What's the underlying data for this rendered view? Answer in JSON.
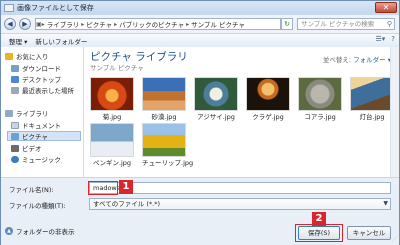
{
  "window": {
    "title": "画像ファイルとして保存",
    "close_glyph": "✕"
  },
  "nav": {
    "back_glyph": "◀",
    "forward_glyph": "▶",
    "breadcrumbs": [
      "ライブラリ",
      "ピクチャ",
      "パブリックのピクチャ",
      "サンプル ピクチャ"
    ],
    "separator": "▸",
    "search_placeholder": "サンプル ピクチャの検索"
  },
  "toolbar": {
    "organize": "整理 ▾",
    "new_folder": "新しいフォルダー"
  },
  "sidebar": {
    "items": [
      {
        "label": "お気に入り",
        "icon": "star-icon",
        "color": "#e8b422"
      },
      {
        "label": "ダウンロード",
        "icon": "download-folder-icon",
        "color": "#7a9cc7"
      },
      {
        "label": "デスクトップ",
        "icon": "desktop-icon",
        "color": "#4f8ad1"
      },
      {
        "label": "最近表示した場所",
        "icon": "recent-places-icon",
        "color": "#9aa8b8"
      },
      {
        "label": "ライブラリ",
        "icon": "library-icon",
        "color": "#8fa9c9"
      },
      {
        "label": "ドキュメント",
        "icon": "documents-icon",
        "color": "#c9d4e0"
      },
      {
        "label": "ピクチャ",
        "icon": "pictures-icon",
        "color": "#6aa2d8"
      },
      {
        "label": "ビデオ",
        "icon": "video-icon",
        "color": "#6b6b6b"
      },
      {
        "label": "ミュージック",
        "icon": "music-icon",
        "color": "#3c7ec0"
      }
    ],
    "selected": "ピクチャ"
  },
  "content": {
    "title": "ピクチャ ライブラリ",
    "subtitle": "サンプル ピクチャ",
    "arrange_label": "並べ替え:",
    "arrange_value": "フォルダー ▾",
    "thumbnails": [
      {
        "caption": "菊.jpg",
        "color": "#d94a12"
      },
      {
        "caption": "砂漠.jpg",
        "color": "#c0722e"
      },
      {
        "caption": "アジサイ.jpg",
        "color": "#4e7d9c"
      },
      {
        "caption": "クラゲ.jpg",
        "color": "#c66a1d"
      },
      {
        "caption": "コアラ.jpg",
        "color": "#8b8a80"
      },
      {
        "caption": "灯台.jpg",
        "color": "#3e6f9a"
      },
      {
        "caption": "ペンギン.jpg",
        "color": "#7fa7c9"
      },
      {
        "caption": "チューリップ.jpg",
        "color": "#e3b316"
      }
    ]
  },
  "bottom": {
    "filename_label": "ファイル名(N):",
    "filename_value": "madowaku",
    "filetype_label": "ファイルの種類(T):",
    "filetype_value": "すべてのファイル (*.*)",
    "save_label": "保存(S)",
    "cancel_label": "キャンセル",
    "hide_folders": "フォルダーの非表示"
  },
  "annotations": {
    "callout1": "1",
    "callout2": "2",
    "color": "#d8262c"
  }
}
